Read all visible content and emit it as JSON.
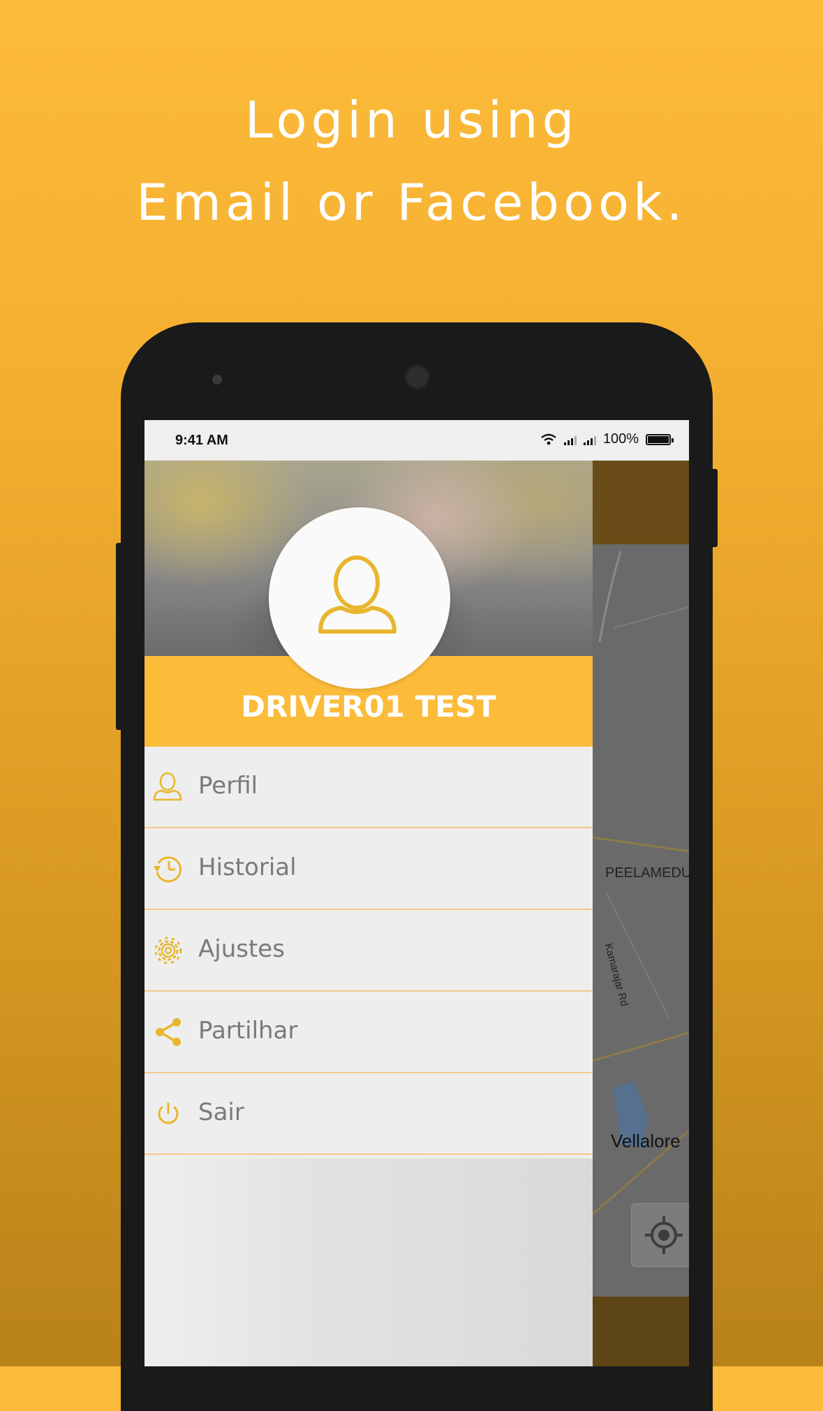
{
  "headline": {
    "line1": "Login using",
    "line2": "Email or Facebook."
  },
  "statusbar": {
    "time": "9:41 AM",
    "battery": "100%"
  },
  "drawer": {
    "driver_name": "DRIVER01 TEST",
    "menu": [
      {
        "label": "Perfil",
        "icon": "user-icon"
      },
      {
        "label": "Historial",
        "icon": "history-icon"
      },
      {
        "label": "Ajustes",
        "icon": "gear-icon"
      },
      {
        "label": "Partilhar",
        "icon": "share-icon"
      },
      {
        "label": "Sair",
        "icon": "power-icon"
      }
    ]
  },
  "map": {
    "labels": [
      "PEELAMEDU",
      "Vellalore",
      "Kamarajar Rd"
    ]
  },
  "colors": {
    "accent": "#fdbb3a",
    "icon": "#e8b62e",
    "menu_text": "#7a7a7a",
    "divider": "#f3c98a"
  }
}
